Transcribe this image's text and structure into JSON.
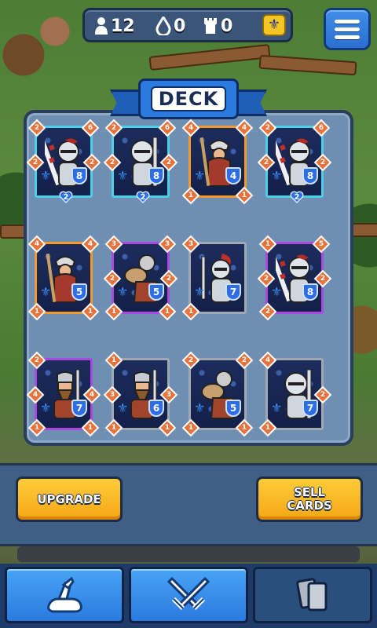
{
  "header": {
    "population": "12",
    "water": "0",
    "towers": "0"
  },
  "deck_title": "DECK",
  "cards": [
    {
      "top_left": "2",
      "top_right": "6",
      "left": "2",
      "right": "2",
      "shield": "8",
      "bottom": "2",
      "frame": "cyan",
      "figure": "knight-halberd"
    },
    {
      "top_left": "2",
      "top_right": "6",
      "left": "2",
      "right": "2",
      "shield": "8",
      "bottom": "2",
      "frame": "cyan",
      "figure": "knight-helm"
    },
    {
      "top_left": "4",
      "top_right": "4",
      "left": "",
      "right": "",
      "shield": "4",
      "bottom": "1",
      "bottom_right": "1",
      "frame": "orange",
      "figure": "hooded-soldier"
    },
    {
      "top_left": "2",
      "top_right": "6",
      "left": "2",
      "right": "2",
      "shield": "8",
      "bottom": "2",
      "frame": "cyan",
      "figure": "knight-halberd"
    },
    {
      "top_left": "4",
      "top_right": "4",
      "left": "",
      "right": "",
      "shield": "5",
      "bottom": "1",
      "bottom_right": "1",
      "frame": "orange",
      "figure": "hooded-soldier"
    },
    {
      "top_left": "3",
      "top_right": "3",
      "left": "2",
      "right": "2",
      "shield": "5",
      "bottom": "1",
      "bottom_right": "1",
      "frame": "purple",
      "figure": "bellows-man"
    },
    {
      "top_left": "3",
      "top_right": "",
      "left": "",
      "right": "",
      "shield": "7",
      "bottom": "1",
      "bottom_right": "",
      "frame": "grey",
      "figure": "knight-feather"
    },
    {
      "top_left": "1",
      "top_right": "5",
      "left": "2",
      "right": "2",
      "shield": "8",
      "bottom": "2",
      "frame": "purple",
      "figure": "knight-halberd"
    },
    {
      "top_left": "2",
      "top_right": "",
      "left": "4",
      "right": "4",
      "shield": "7",
      "bottom": "1",
      "bottom_right": "1",
      "frame": "purple",
      "figure": "bearded-warrior"
    },
    {
      "top_left": "1",
      "top_right": "",
      "left": "3",
      "right": "3",
      "shield": "6",
      "bottom": "1",
      "bottom_right": "1",
      "frame": "grey",
      "figure": "bearded-warrior"
    },
    {
      "top_left": "2",
      "top_right": "2",
      "left": "",
      "right": "",
      "shield": "5",
      "bottom": "1",
      "bottom_right": "1",
      "frame": "grey",
      "figure": "bellows-man"
    },
    {
      "top_left": "4",
      "top_right": "",
      "left": "",
      "right": "2",
      "shield": "7",
      "bottom": "1",
      "bottom_right": "",
      "frame": "grey",
      "figure": "knight-helm"
    }
  ],
  "buttons": {
    "upgrade": "UPGRADE",
    "sell_cards": "SELL CARDS"
  },
  "nav": [
    {
      "name": "bag-icon",
      "active": true
    },
    {
      "name": "crossed-swords-icon",
      "active": true
    },
    {
      "name": "cards-icon",
      "active": false
    }
  ]
}
